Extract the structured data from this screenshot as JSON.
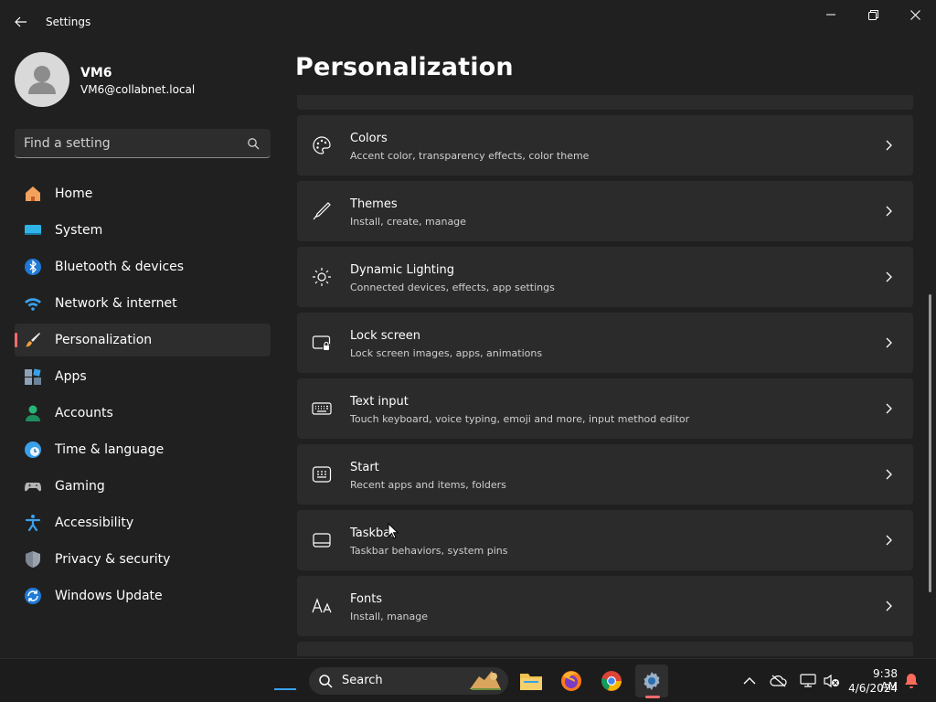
{
  "window": {
    "app_title": "Settings",
    "controls": [
      "minimize",
      "maximize",
      "close"
    ]
  },
  "profile": {
    "name": "VM6",
    "email": "VM6@collabnet.local"
  },
  "search": {
    "placeholder": "Find a setting"
  },
  "nav": {
    "items": [
      {
        "label": "Home",
        "icon": "home-icon"
      },
      {
        "label": "System",
        "icon": "system-icon"
      },
      {
        "label": "Bluetooth & devices",
        "icon": "bluetooth-icon"
      },
      {
        "label": "Network & internet",
        "icon": "wifi-icon"
      },
      {
        "label": "Personalization",
        "icon": "brush-icon",
        "active": true
      },
      {
        "label": "Apps",
        "icon": "apps-icon"
      },
      {
        "label": "Accounts",
        "icon": "accounts-icon"
      },
      {
        "label": "Time & language",
        "icon": "clock-globe-icon"
      },
      {
        "label": "Gaming",
        "icon": "gamepad-icon"
      },
      {
        "label": "Accessibility",
        "icon": "accessibility-icon"
      },
      {
        "label": "Privacy & security",
        "icon": "shield-icon"
      },
      {
        "label": "Windows Update",
        "icon": "update-icon"
      }
    ],
    "active_color": "#ff6b6b"
  },
  "main": {
    "title": "Personalization",
    "cards": [
      {
        "title": "Colors",
        "description": "Accent color, transparency effects, color theme",
        "icon": "palette-icon"
      },
      {
        "title": "Themes",
        "description": "Install, create, manage",
        "icon": "pen-brush-icon"
      },
      {
        "title": "Dynamic Lighting",
        "description": "Connected devices, effects, app settings",
        "icon": "sun-lighting-icon"
      },
      {
        "title": "Lock screen",
        "description": "Lock screen images, apps, animations",
        "icon": "lock-screen-icon"
      },
      {
        "title": "Text input",
        "description": "Touch keyboard, voice typing, emoji and more, input method editor",
        "icon": "keyboard-icon"
      },
      {
        "title": "Start",
        "description": "Recent apps and items, folders",
        "icon": "start-menu-icon"
      },
      {
        "title": "Taskbar",
        "description": "Taskbar behaviors, system pins",
        "icon": "taskbar-icon"
      },
      {
        "title": "Fonts",
        "description": "Install, manage",
        "icon": "fonts-icon"
      }
    ]
  },
  "taskbar": {
    "search_label": "Search",
    "apps": [
      "file-explorer-icon",
      "firefox-icon",
      "chrome-icon",
      "settings-icon"
    ],
    "tray": [
      "chevron-up-icon",
      "cloud-off-icon",
      "network-icon",
      "volume-muted-icon",
      "notification-bell-icon"
    ],
    "time": "9:38 AM",
    "date": "4/6/2024"
  }
}
